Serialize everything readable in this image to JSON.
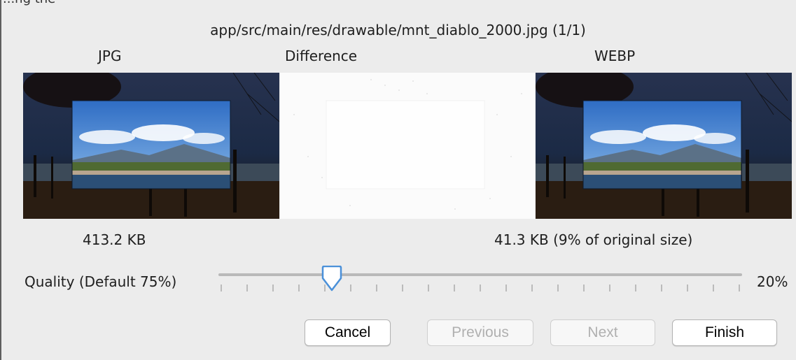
{
  "window": {
    "top_strip_text": "...ng the",
    "file_title": "app/src/main/res/drawable/mnt_diablo_2000.jpg (1/1)"
  },
  "columns": {
    "jpg_label": "JPG",
    "difference_label": "Difference",
    "webp_label": "WEBP"
  },
  "sizes": {
    "jpg_size": "413.2 KB",
    "webp_size": "41.3 KB (9% of original size)"
  },
  "quality": {
    "label": "Quality (Default 75%)",
    "value_text": "20%",
    "value": 20,
    "min": 0,
    "max": 100
  },
  "buttons": {
    "cancel": "Cancel",
    "previous": "Previous",
    "next": "Next",
    "finish": "Finish"
  },
  "colors": {
    "accent": "#4a90d9",
    "disabled_text": "#b0b0b0"
  }
}
